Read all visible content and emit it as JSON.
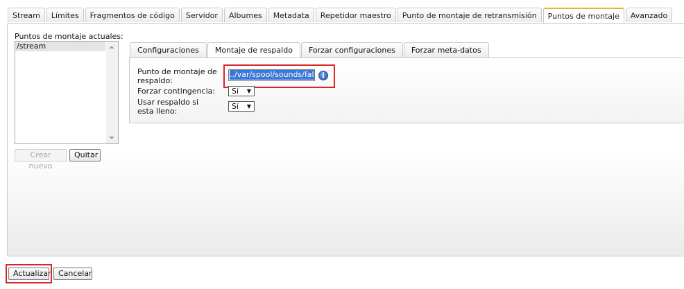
{
  "top_tabs": [
    {
      "label": "Stream",
      "active": false
    },
    {
      "label": "Límites",
      "active": false
    },
    {
      "label": "Fragmentos de código",
      "active": false
    },
    {
      "label": "Servidor",
      "active": false
    },
    {
      "label": "Albumes",
      "active": false
    },
    {
      "label": "Metadata",
      "active": false
    },
    {
      "label": "Repetidor maestro",
      "active": false
    },
    {
      "label": "Punto de montaje de retransmisión",
      "active": false
    },
    {
      "label": "Puntos de montaje",
      "active": true
    },
    {
      "label": "Avanzado",
      "active": false
    }
  ],
  "mounts": {
    "label": "Puntos de montaje actuales:",
    "items": [
      "/stream"
    ],
    "create_label": "Crear nuevo",
    "remove_label": "Quitar"
  },
  "inner_tabs": [
    {
      "label": "Configuraciones",
      "active": false
    },
    {
      "label": "Montaje de respaldo",
      "active": true
    },
    {
      "label": "Forzar configuraciones",
      "active": false
    },
    {
      "label": "Forzar meta-datos",
      "active": false
    }
  ],
  "fields": {
    "fallback_label": "Punto de montaje de respaldo:",
    "fallback_value": "../var/spool/sounds/fallb",
    "force_contingency_label": "Forzar contingencia:",
    "force_contingency_value": "Sí",
    "use_if_full_label": "Usar respaldo si esta lleno:",
    "use_if_full_value": "Sí"
  },
  "footer": {
    "update_label": "Actualizar",
    "cancel_label": "Cancelar"
  },
  "colors": {
    "highlight_red": "#d9262b",
    "active_tab_accent": "#e7b23a",
    "selection_blue": "#3b78d8"
  }
}
